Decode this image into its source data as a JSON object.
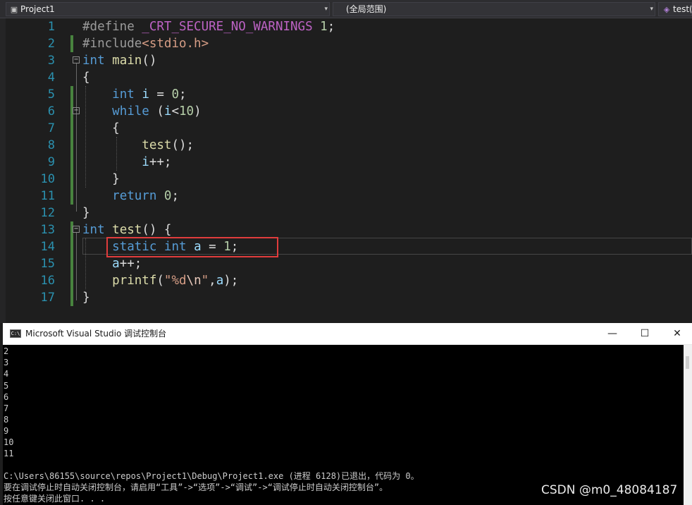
{
  "navbar": {
    "project": "Project1",
    "scope": "(全局范围)",
    "member": "test()"
  },
  "editor": {
    "line_numbers": [
      "1",
      "2",
      "3",
      "4",
      "5",
      "6",
      "7",
      "8",
      "9",
      "10",
      "11",
      "12",
      "13",
      "14",
      "15",
      "16",
      "17"
    ],
    "tokens": {
      "l1": [
        "#define ",
        "_CRT_SECURE_NO_WARNINGS",
        " ",
        "1",
        ";"
      ],
      "l2": [
        "#include",
        "<stdio.h>"
      ],
      "l3": [
        "int",
        " ",
        "main",
        "()"
      ],
      "l4": [
        "{"
      ],
      "l5": [
        "    ",
        "int",
        " ",
        "i",
        " = ",
        "0",
        ";"
      ],
      "l6": [
        "    ",
        "while",
        " (",
        "i",
        "<",
        "10",
        ")"
      ],
      "l7": [
        "    ",
        "{"
      ],
      "l8": [
        "        ",
        "test",
        "();"
      ],
      "l9": [
        "        ",
        "i",
        "++;"
      ],
      "l10": [
        "    ",
        "}"
      ],
      "l11": [
        "    ",
        "return",
        " ",
        "0",
        ";"
      ],
      "l12": [
        "}"
      ],
      "l13": [
        "int",
        " ",
        "test",
        "() {"
      ],
      "l14": [
        "    ",
        "static",
        " ",
        "int",
        " ",
        "a",
        " = ",
        "1",
        ";"
      ],
      "l15": [
        "    ",
        "a",
        "++;"
      ],
      "l16": [
        "    ",
        "printf",
        "(",
        "\"%d",
        "\\n",
        "\"",
        ",",
        "a",
        ");"
      ],
      "l17": [
        "}"
      ]
    }
  },
  "console": {
    "title": "Microsoft Visual Studio 调试控制台",
    "icon_label": "C:\\",
    "output_lines": [
      "2",
      "3",
      "4",
      "5",
      "6",
      "7",
      "8",
      "9",
      "10",
      "11"
    ],
    "exit_line": "C:\\Users\\86155\\source\\repos\\Project1\\Debug\\Project1.exe (进程 6128)已退出，代码为 0。",
    "hint_line": "要在调试停止时自动关闭控制台，请启用“工具”->“选项”->“调试”->“调试停止时自动关闭控制台”。",
    "press_line": "按任意键关闭此窗口. . .",
    "buttons": {
      "minimize": "—",
      "maximize": "☐",
      "close": "✕"
    }
  },
  "watermark": "CSDN @m0_48084187",
  "icons": {
    "project": "cpp-project-icon",
    "member": "function-icon",
    "console": "console-app-icon"
  },
  "colors": {
    "keyword": "#569cd6",
    "function": "#dcdcaa",
    "variable": "#9cdcfe",
    "number": "#b5cea8",
    "string": "#d69d85",
    "macro": "#bd63c5",
    "line_number": "#2b91af",
    "highlight_box": "#e03c3c"
  }
}
